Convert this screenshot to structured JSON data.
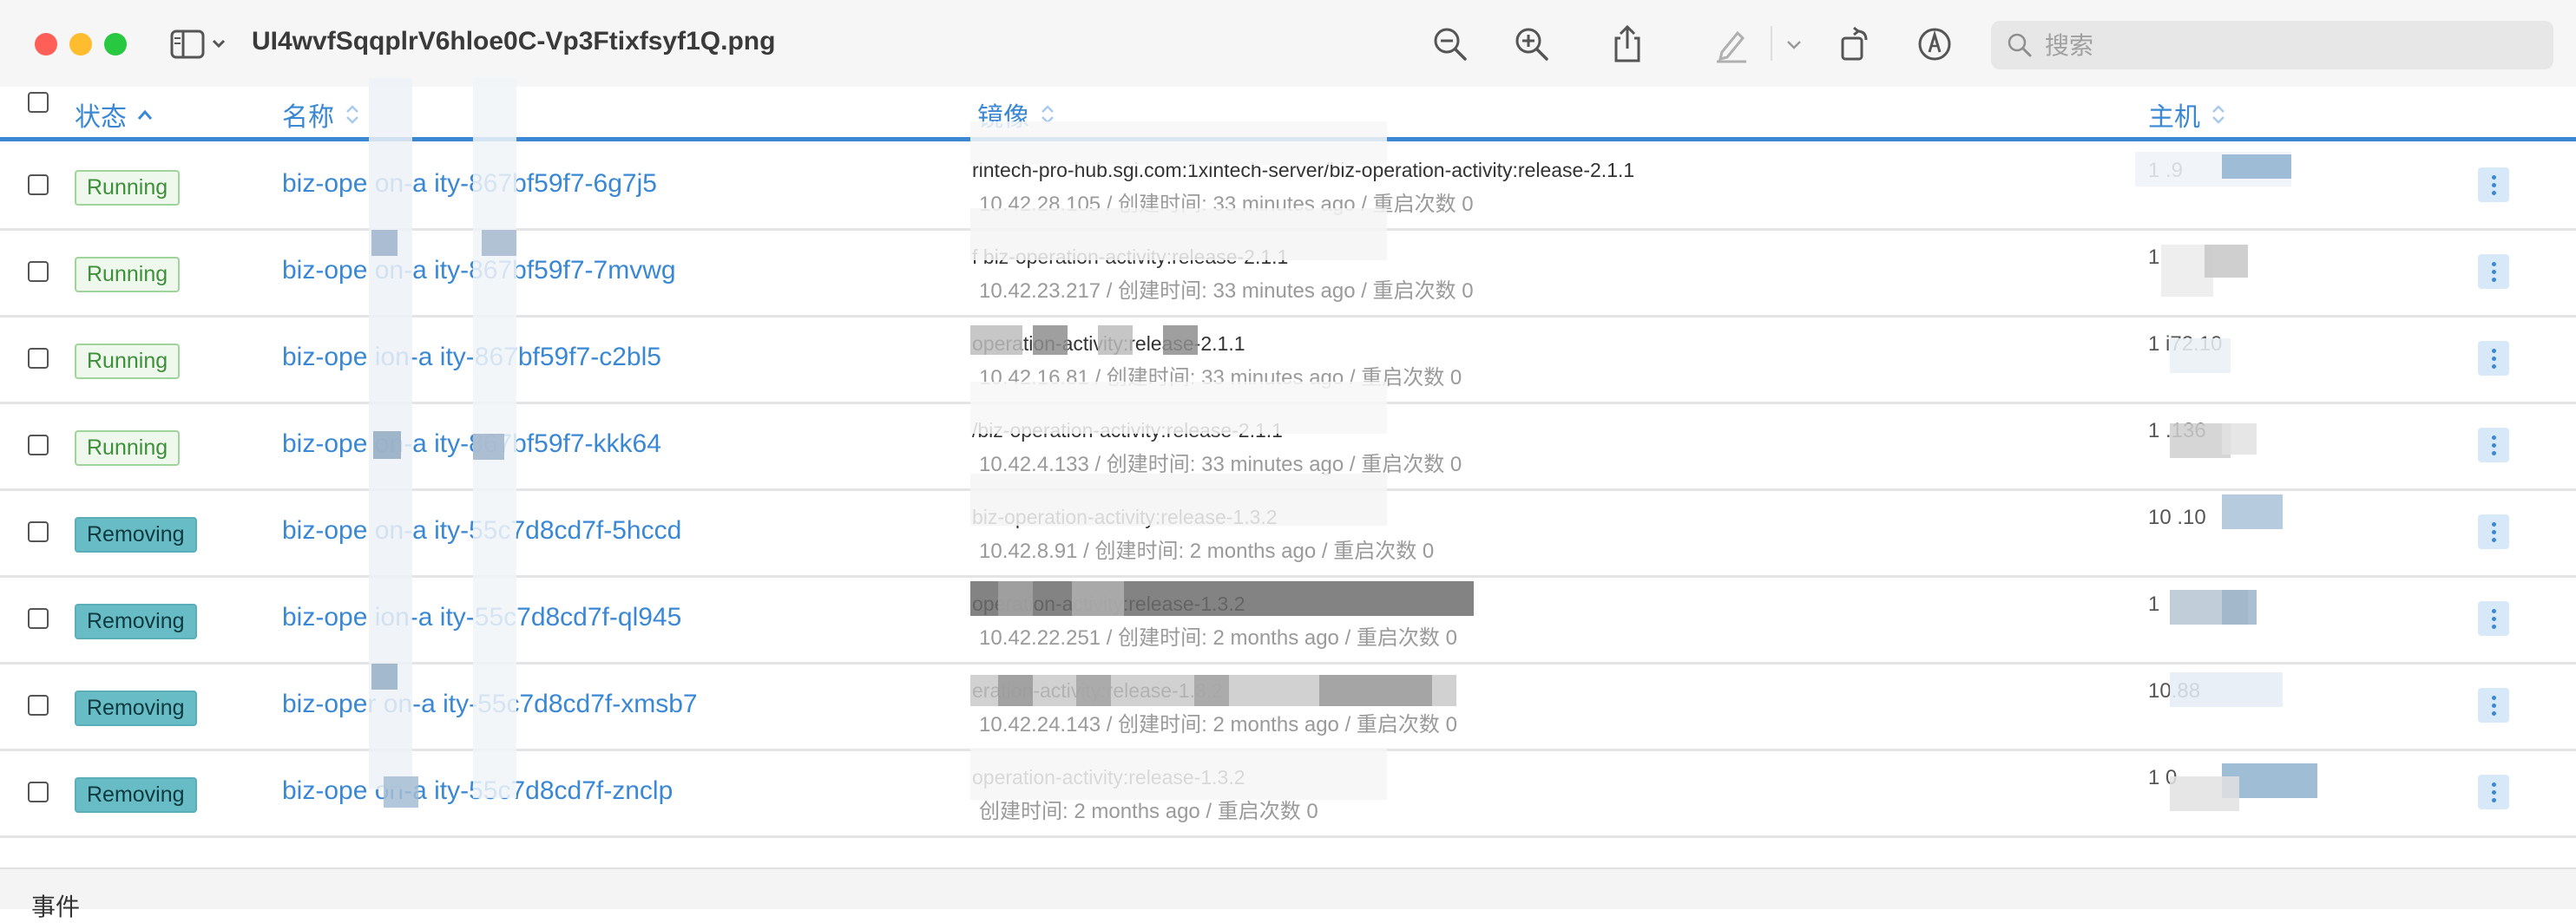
{
  "window": {
    "title": "UI4wvfSqqplrV6hloe0C-Vp3Ftixfsyf1Q.png"
  },
  "toolbar": {
    "icons": [
      "zoom-out-icon",
      "zoom-in-icon",
      "share-icon",
      "markup-pen-icon",
      "chevron-down-icon",
      "rotate-icon",
      "annotate-icon"
    ],
    "search_placeholder": "搜索"
  },
  "table": {
    "columns": [
      {
        "label": "状态",
        "sort": "ascending"
      },
      {
        "label": "名称",
        "sort": "none"
      },
      {
        "label": "镜像",
        "sort": "none"
      },
      {
        "label": "主机",
        "sort": "none"
      }
    ],
    "rows": [
      {
        "status": "Running",
        "status_kind": "running",
        "name": "biz-ope on-a ity-867bf59f7-6g7j5",
        "image": "rintech-pro-hub.sgi.com:1xintech-server/biz-operation-activity:release-2.1.1",
        "meta": "10.42.28.105 / 创建时间: 33 minutes ago / 重启次数 0",
        "host": "1         .9"
      },
      {
        "status": "Running",
        "status_kind": "running",
        "name": "biz-ope on-a ity-867bf59f7-7mvwg",
        "image": "f                                  biz-operation-activity:release-2.1.1",
        "meta": "10.42.23.217 / 创建时间: 33 minutes ago / 重启次数 0",
        "host": "1"
      },
      {
        "status": "Running",
        "status_kind": "running",
        "name": "biz-ope ion-a ity-867bf59f7-c2bl5",
        "image": "operation-activity:release-2.1.1",
        "meta": "10.42.16.81 / 创建时间: 33 minutes ago / 重启次数 0",
        "host": "1      i72.10"
      },
      {
        "status": "Running",
        "status_kind": "running",
        "name": "biz-ope on-a ity-867bf59f7-kkk64",
        "image": "/biz-operation-activity:release-2.1.1",
        "meta": "10.42.4.133 / 创建时间: 33 minutes ago / 重启次数 0",
        "host": "1       .136"
      },
      {
        "status": "Removing",
        "status_kind": "removing",
        "name": "biz-ope on-a ity-55c7d8cd7f-5hccd",
        "image": "biz-operation-activity:release-1.3.2",
        "meta": "10.42.8.91 / 创建时间: 2 months ago / 重启次数 0",
        "host": "10         .10"
      },
      {
        "status": "Removing",
        "status_kind": "removing",
        "name": "biz-ope ion-a ity-55c7d8cd7f-ql945",
        "image": "operation-activity:release-1.3.2",
        "meta": "10.42.22.251 / 创建时间: 2 months ago / 重启次数 0",
        "host": "1"
      },
      {
        "status": "Removing",
        "status_kind": "removing",
        "name": "biz-oper on-a ity-55c7d8cd7f-xmsb7",
        "image": "eration-activity:release-1.3.2",
        "meta": "10.42.24.143 / 创建时间: 2 months ago / 重启次数 0",
        "host": "10.88"
      },
      {
        "status": "Removing",
        "status_kind": "removing",
        "name": "biz-ope on-a ity-55c7d8cd7f-znclp",
        "image": "operation-activity:release-1.3.2",
        "meta": "创建时间: 2 months ago / 重启次数 0",
        "host": "1         0"
      }
    ]
  },
  "footer": {
    "label": "事件"
  },
  "colors": {
    "accent": "#3a88d4",
    "running_bg": "#eef8ec",
    "running_border": "#9fd49a",
    "removing_bg": "#67bcc6"
  }
}
